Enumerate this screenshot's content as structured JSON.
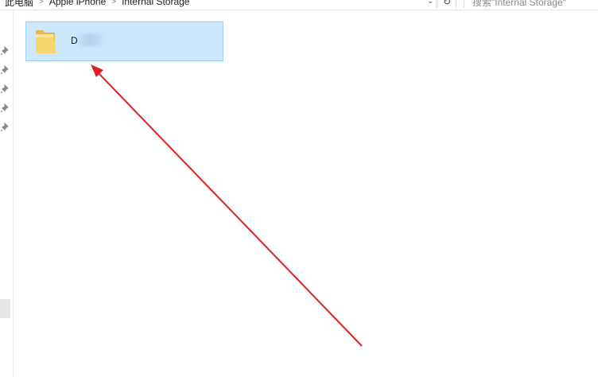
{
  "address_bar": {
    "breadcrumbs": [
      "此电脑",
      "Apple iPhone",
      "Internal Storage"
    ],
    "separator": ">",
    "dropdown_icon": "chevron-down-icon",
    "refresh_icon": "refresh-icon"
  },
  "search": {
    "placeholder": "搜索\"Internal Storage\""
  },
  "nav_pane": {
    "pin_icon": "pin-icon",
    "pinned_count": 5
  },
  "content": {
    "items": [
      {
        "name": "D",
        "type": "folder",
        "selected": true
      }
    ]
  },
  "colors": {
    "selection_fill": "#cce8ff",
    "selection_border": "#99d1ff",
    "folder_yellow": "#f5d06a",
    "annotation_arrow": "#e02020"
  }
}
